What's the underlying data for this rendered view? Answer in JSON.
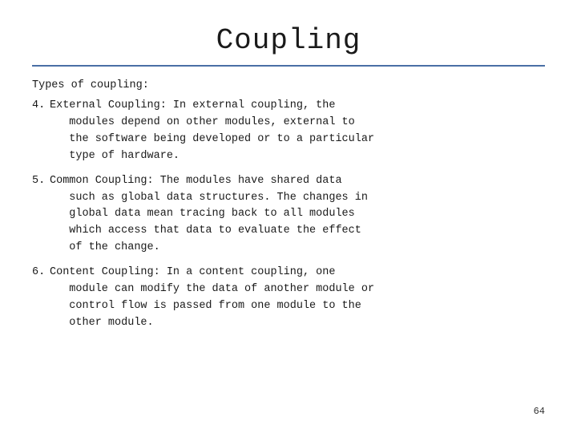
{
  "slide": {
    "title": "Coupling",
    "section_heading": "Types of coupling:",
    "items": [
      {
        "number": "4.",
        "text": "External Coupling: In external coupling, the\n   modules depend on other modules, external to\n   the software being developed or to a particular\n   type of hardware."
      },
      {
        "number": "5.",
        "text": "Common Coupling: The modules have shared data\n   such as global data structures. The changes in\n   global data mean tracing back to all modules\n   which access that data to evaluate the effect\n   of the change."
      },
      {
        "number": "6.",
        "text": "Content Coupling: In a content coupling, one\n   module can modify the data of another module or\n   control flow is passed from one module to the\n   other module."
      }
    ],
    "page_number": "64"
  }
}
